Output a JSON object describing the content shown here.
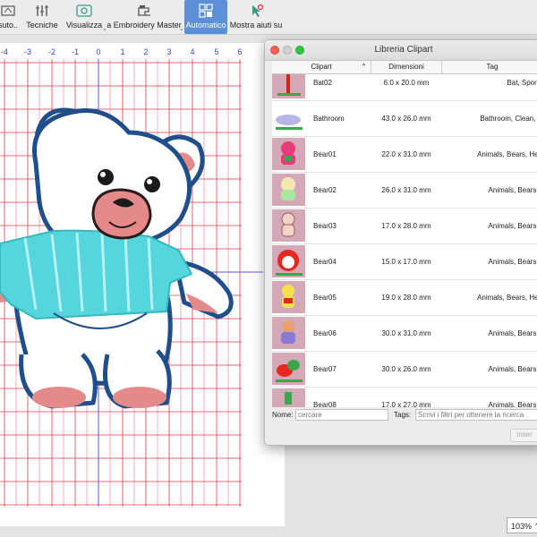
{
  "toolbar": {
    "items": [
      {
        "label": "suto..",
        "icon": "auto-digitize-icon"
      },
      {
        "label": "Tecniche",
        "icon": "techniques-icon"
      },
      {
        "label": "Visualizza",
        "icon": "view-icon"
      },
      {
        "label": "a Embroidery Master",
        "icon": "sewing-machine-icon"
      },
      {
        "label": "Automatico",
        "icon": "automatic-icon",
        "active": true
      },
      {
        "label": "Mostra aiuti su",
        "icon": "help-pointer-icon"
      }
    ]
  },
  "ruler": {
    "labels": [
      "-4",
      "-3",
      "-2",
      "-1",
      "0",
      "1",
      "2",
      "3",
      "4",
      "5",
      "6"
    ]
  },
  "clipart_window": {
    "title": "Libreria Clipart",
    "columns": {
      "clipart": "Clipart",
      "dimensions": "Dimensioni",
      "tag": "Tag"
    },
    "rows": [
      {
        "name": "Bat02",
        "dims": "6.0 x 20.0 mm",
        "tags": "Bat, Sports"
      },
      {
        "name": "Bathroom",
        "dims": "43.0 x 26.0 mm",
        "tags": "Bathroom, Clean, S"
      },
      {
        "name": "Bear01",
        "dims": "22.0 x 31.0 mm",
        "tags": "Animals, Bears, Hea"
      },
      {
        "name": "Bear02",
        "dims": "26.0 x 31.0 mm",
        "tags": "Animals, Bears, I"
      },
      {
        "name": "Bear03",
        "dims": "17.0 x 28.0 mm",
        "tags": "Animals, Bears, I"
      },
      {
        "name": "Bear04",
        "dims": "15.0 x 17.0 mm",
        "tags": "Animals, Bears, I"
      },
      {
        "name": "Bear05",
        "dims": "19.0 x 28.0 mm",
        "tags": "Animals, Bears, Hea"
      },
      {
        "name": "Bear06",
        "dims": "30.0 x 31.0 mm",
        "tags": "Animals, Bears, I"
      },
      {
        "name": "Bear07",
        "dims": "30.0 x 26.0 mm",
        "tags": "Animals, Bears, I"
      },
      {
        "name": "Bear08",
        "dims": "17.0 x 27.0 mm",
        "tags": "Animals, Bears, I"
      }
    ],
    "form": {
      "name_label": "Nome:",
      "name_placeholder": "cercare",
      "tags_label": "Tags:",
      "tags_placeholder": "Scrivi i filtri per ottenere la ricerca",
      "insert_button": "Inser"
    }
  },
  "status": {
    "zoom": "103%"
  },
  "colors": {
    "accent": "#5b8fd6",
    "grid_red": "#e8394a",
    "axis_blue": "#5a5ae8",
    "bear_outline": "#1f4e8a",
    "shirt": "#55d6dc",
    "ears": "#e58a8a"
  }
}
